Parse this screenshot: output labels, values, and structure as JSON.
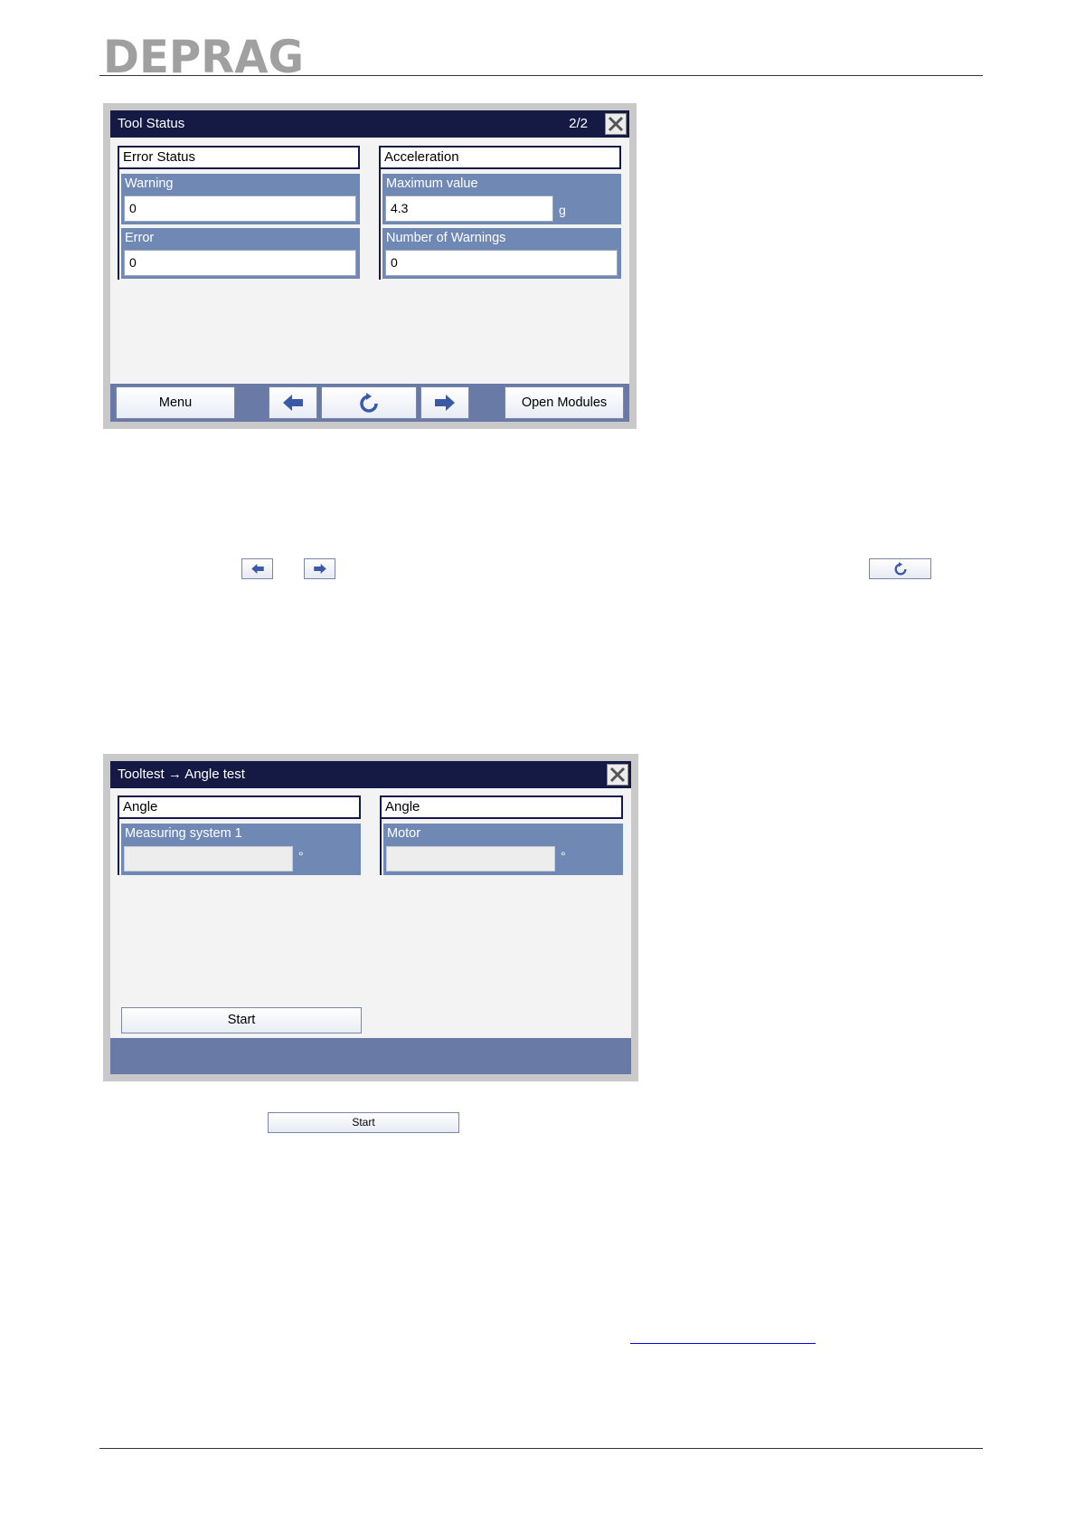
{
  "header": {
    "logo_text": "DEPRAG"
  },
  "tool_status": {
    "title": "Tool Status",
    "page": "2/2",
    "left_group": {
      "heading": "Error Status",
      "fields": [
        {
          "label": "Warning",
          "value": "0"
        },
        {
          "label": "Error",
          "value": "0"
        }
      ]
    },
    "right_group": {
      "heading": "Acceleration",
      "fields": [
        {
          "label": "Maximum value",
          "value": "4.3",
          "unit": "g"
        },
        {
          "label": "Number of Warnings",
          "value": "0"
        }
      ]
    },
    "buttons": {
      "menu": "Menu",
      "open_modules": "Open Modules"
    }
  },
  "angle_test": {
    "title": "Tooltest → Angle test",
    "left_group": {
      "heading": "Angle",
      "field": {
        "label": "Measuring system 1",
        "value": "",
        "unit": "°"
      }
    },
    "right_group": {
      "heading": "Angle",
      "field": {
        "label": "Motor",
        "value": "",
        "unit": "°"
      }
    },
    "start_label": "Start"
  },
  "standalone": {
    "start_label": "Start"
  },
  "icons": [
    "arrow-left-icon",
    "refresh-icon",
    "arrow-right-icon",
    "close-icon"
  ],
  "colors": {
    "titlebar": "#141a43",
    "field_bg": "#7088b4",
    "bar_bg": "#6a7aa6"
  }
}
